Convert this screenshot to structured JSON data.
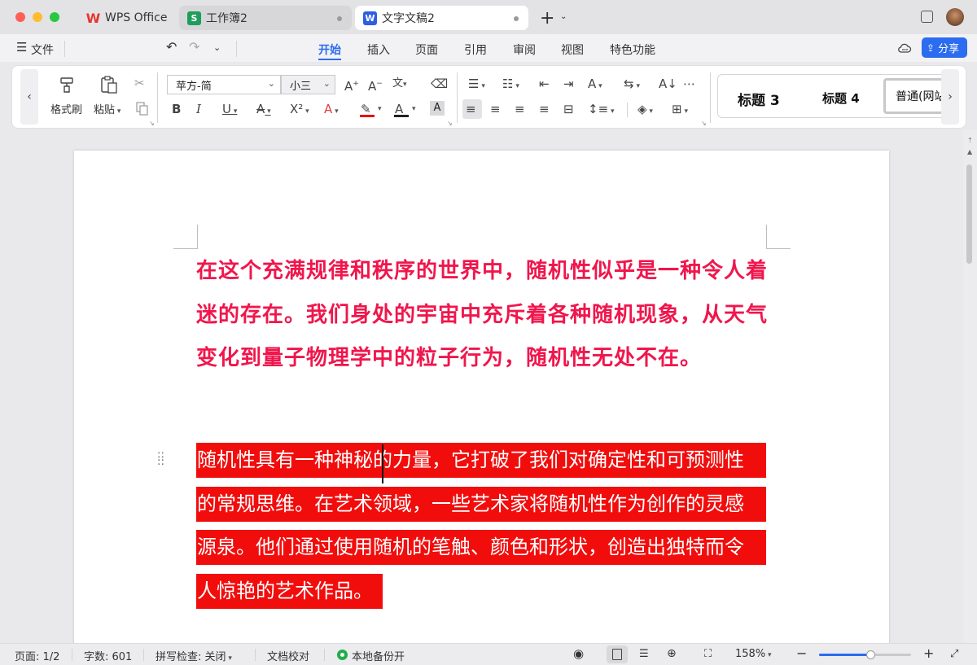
{
  "tabs": [
    {
      "label": "WPS Office",
      "logo": "W"
    },
    {
      "label": "工作簿2",
      "logo": "S"
    },
    {
      "label": "文字文稿2",
      "logo": "W"
    }
  ],
  "menu": {
    "file": "文件",
    "items": [
      "开始",
      "插入",
      "页面",
      "引用",
      "审阅",
      "视图",
      "特色功能"
    ],
    "active": "开始",
    "share": "分享"
  },
  "ribbon": {
    "format_painter": "格式刷",
    "paste": "粘贴",
    "font_name": "苹方-简",
    "font_size": "小三",
    "styles": [
      "标题 3",
      "标题 4",
      "普通(网站"
    ]
  },
  "document": {
    "para1": "在这个充满规律和秩序的世界中，随机性似乎是一种令人着迷的存在。我们身处的宇宙中充斥着各种随机现象，从天气变化到量子物理学中的粒子行为，随机性无处不在。",
    "para2_lines": [
      "随机性具有一种神秘的力量，它打破了我们对确定性和可预测性",
      "的常规思维。在艺术领域，一些艺术家将随机性作为创作的灵感",
      "源泉。他们通过使用随机的笔触、颜色和形状，创造出独特而令",
      "人惊艳的艺术作品。"
    ],
    "para1_color": "#f0164c",
    "highlight_color": "#f20d0d"
  },
  "status": {
    "page": "页面: 1/2",
    "words": "字数: 601",
    "spell": "拼写检查: 关闭",
    "proof": "文档校对",
    "backup": "本地备份开",
    "zoom": "158%"
  },
  "colors": {
    "accent": "#2b6cf0",
    "wps_red": "#e8352e",
    "sheet_green": "#1e9e5a",
    "writer_blue": "#2d5fe0"
  }
}
